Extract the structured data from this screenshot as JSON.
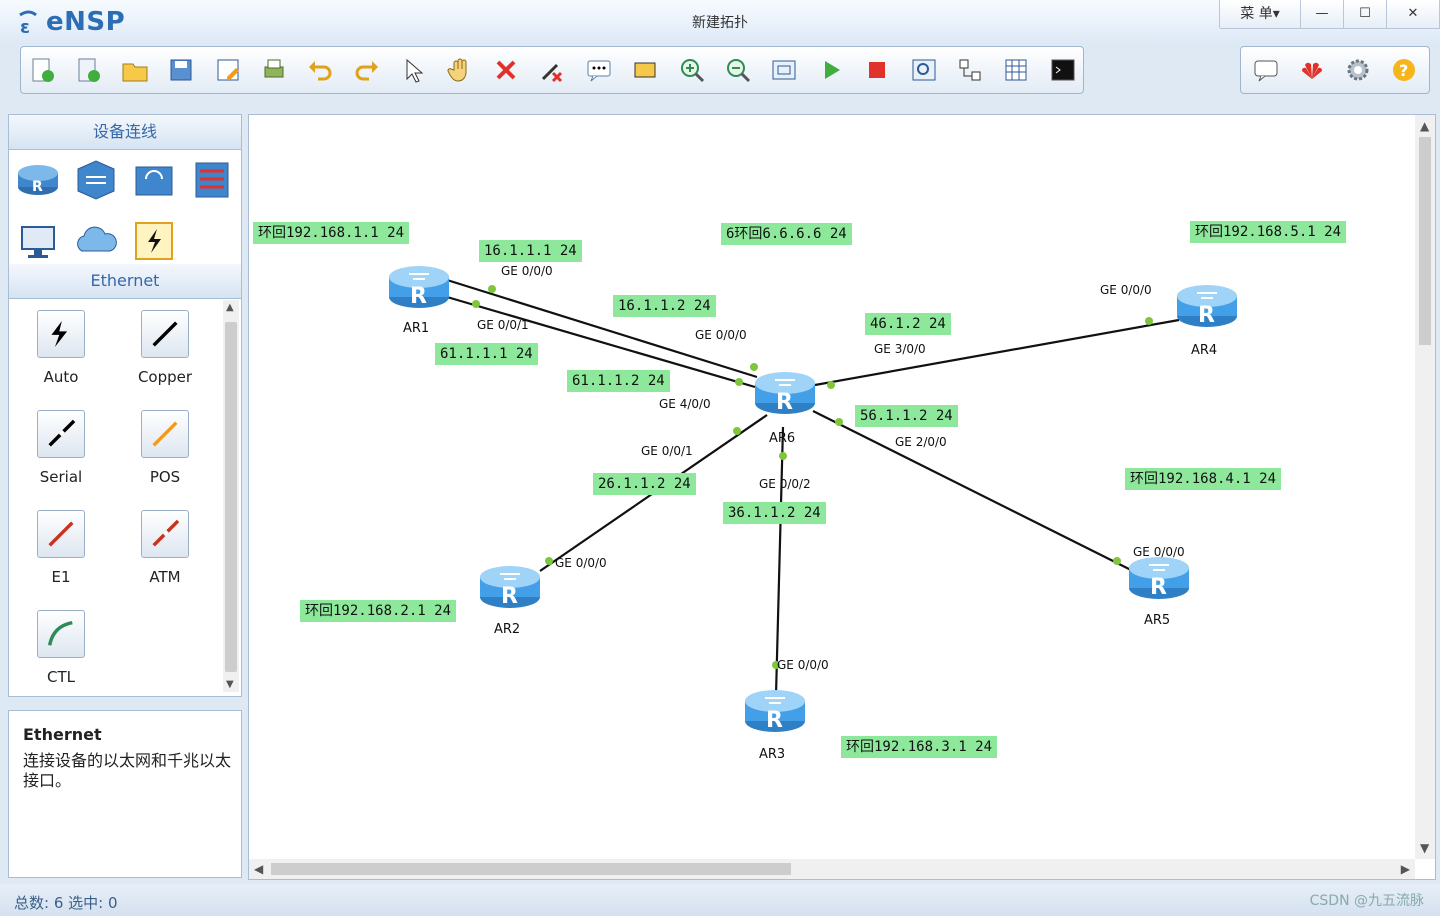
{
  "app": {
    "name": "eNSP",
    "window_title": "新建拓扑"
  },
  "window_controls": {
    "menu": "菜 单▾",
    "minimize": "—",
    "maximize": "☐",
    "close": "✕"
  },
  "toolbar": {
    "icons": [
      "new-topology-icon",
      "new-lab-icon",
      "open-icon",
      "save-icon",
      "save-as-icon",
      "print-icon",
      "undo-icon",
      "redo-icon",
      "select-icon",
      "pan-hand-icon",
      "delete-icon",
      "delete-link-icon",
      "text-annotation-icon",
      "rectangle-icon",
      "zoom-in-icon",
      "zoom-out-icon",
      "fit-view-icon",
      "start-device-icon",
      "stop-device-icon",
      "capture-icon",
      "topology-tree-icon",
      "grid-icon",
      "cli-icon"
    ],
    "side_icons": [
      "chat-icon",
      "huawei-icon",
      "settings-icon",
      "help-icon"
    ]
  },
  "left_panel": {
    "device_header": "设备连线",
    "devices": [
      "router-icon",
      "switch-icon",
      "wlan-icon",
      "firewall-icon",
      "pc-icon",
      "cloud-icon",
      "link-icon"
    ],
    "category_header": "Ethernet",
    "cables": [
      {
        "label": "Auto",
        "icon": "auto-cable-icon",
        "color": "#000000"
      },
      {
        "label": "Copper",
        "icon": "copper-cable-icon",
        "color": "#000000"
      },
      {
        "label": "Serial",
        "icon": "serial-cable-icon",
        "color": "#000000"
      },
      {
        "label": "POS",
        "icon": "pos-cable-icon",
        "color": "#f39a1e"
      },
      {
        "label": "E1",
        "icon": "e1-cable-icon",
        "color": "#c8321e"
      },
      {
        "label": "ATM",
        "icon": "atm-cable-icon",
        "color": "#c8321e"
      },
      {
        "label": "CTL",
        "icon": "ctl-cable-icon",
        "color": "#2e8b57"
      }
    ],
    "info_title": "Ethernet",
    "info_desc": "连接设备的以太网和千兆以太接口。"
  },
  "topology": {
    "routers": [
      "AR1",
      "AR2",
      "AR3",
      "AR4",
      "AR5",
      "AR6"
    ],
    "labels": [
      "环回192.168.1.1 24",
      "16.1.1.1 24",
      "6环回6.6.6.6 24",
      "环回192.168.5.1 24",
      "16.1.1.2 24",
      "46.1.2 24",
      "61.1.1.1 24",
      "61.1.1.2 24",
      "56.1.1.2 24",
      "26.1.1.2 24",
      "36.1.1.2 24",
      "环回192.168.4.1 24",
      "环回192.168.2.1 24",
      "环回192.168.3.1 24"
    ],
    "ports": [
      "GE 0/0/0",
      "GE 0/0/1",
      "GE 0/0/0",
      "GE 3/0/0",
      "GE 0/0/0",
      "GE 4/0/0",
      "GE 2/0/0",
      "GE 0/0/1",
      "GE 0/0/2",
      "GE 0/0/0",
      "GE 0/0/0",
      "GE 0/0/0"
    ],
    "link_color": "#111111",
    "port_dot_color": "#7ec63a",
    "label_bg": "#8ee89b"
  },
  "status": {
    "text": "总数: 6  选中: 0",
    "watermark": "CSDN @九五流脉"
  }
}
